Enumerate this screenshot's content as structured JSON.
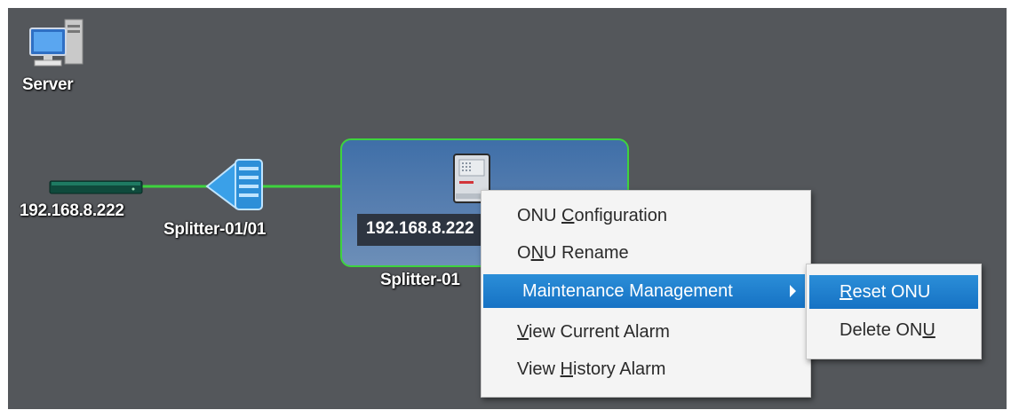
{
  "topology": {
    "server_label": "Server",
    "olt_label": "192.168.8.222",
    "splitter_label": "Splitter-01/01",
    "onu_ip": "192.168.8.222",
    "onu_splitter_label": "Splitter-01"
  },
  "colors": {
    "canvas_bg": "#54575b",
    "link": "#3ed33e",
    "group_border": "#3ed33e",
    "highlight": "#1f7fd0"
  },
  "context_menu": {
    "items": [
      {
        "pre": "ONU ",
        "key": "C",
        "post": "onfiguration"
      },
      {
        "pre": "O",
        "key": "N",
        "post": "U Rename"
      },
      {
        "pre": "Maintenance Management",
        "key": "",
        "post": ""
      },
      {
        "pre": "",
        "key": "V",
        "post": "iew Current Alarm"
      },
      {
        "pre": "View ",
        "key": "H",
        "post": "istory Alarm"
      }
    ]
  },
  "submenu": {
    "items": [
      {
        "pre": "",
        "key": "R",
        "post": "eset ONU"
      },
      {
        "pre": "Delete ON",
        "key": "U",
        "post": ""
      }
    ]
  }
}
